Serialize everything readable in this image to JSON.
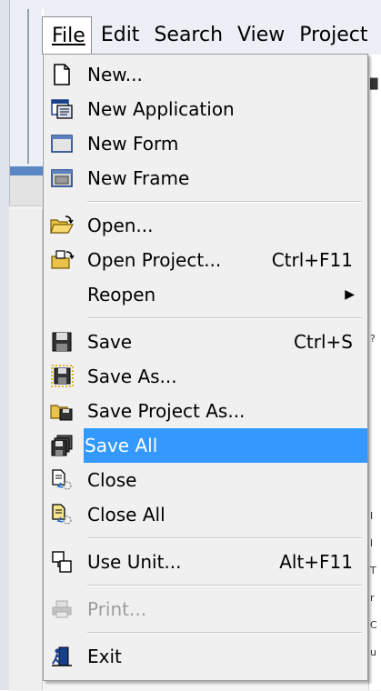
{
  "menubar": {
    "items": [
      {
        "label": "File"
      },
      {
        "label": "Edit"
      },
      {
        "label": "Search"
      },
      {
        "label": "View"
      },
      {
        "label": "Project"
      }
    ]
  },
  "file_menu": {
    "new": "New...",
    "new_application": "New Application",
    "new_form": "New Form",
    "new_frame": "New Frame",
    "open": "Open...",
    "open_project": "Open Project...",
    "open_project_shortcut": "Ctrl+F11",
    "reopen": "Reopen",
    "save": "Save",
    "save_shortcut": "Ctrl+S",
    "save_as": "Save As...",
    "save_project_as": "Save Project As...",
    "save_all": "Save All",
    "close": "Close",
    "close_all": "Close All",
    "use_unit": "Use Unit...",
    "use_unit_shortcut": "Alt+F11",
    "print": "Print...",
    "exit": "Exit"
  },
  "colors": {
    "selection": "#3399ff",
    "menu_background": "#f0f0f0",
    "disabled_text": "#9c9c9c"
  },
  "icons": {
    "new": "blank-page-icon",
    "new_application": "application-icon",
    "new_form": "form-window-icon",
    "new_frame": "frame-window-icon",
    "open": "open-folder-icon",
    "open_project": "open-project-icon",
    "save": "floppy-disk-icon",
    "save_as": "floppy-save-as-icon",
    "save_project_as": "save-project-icon",
    "save_all": "save-all-icon",
    "close": "close-document-icon",
    "close_all": "close-all-icon",
    "use_unit": "use-unit-icon",
    "print": "printer-icon",
    "exit": "exit-door-icon"
  }
}
